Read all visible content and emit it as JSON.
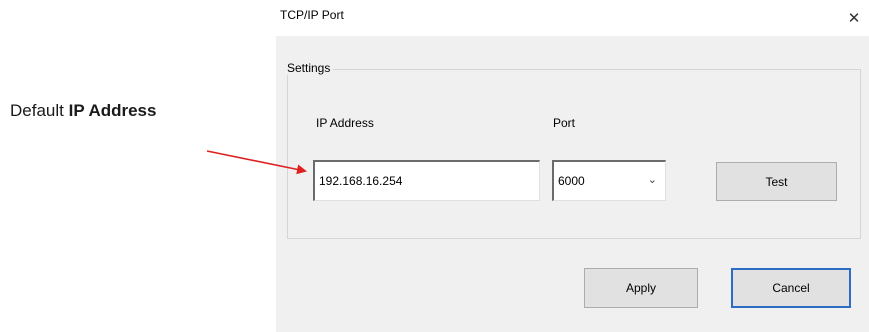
{
  "annotation": {
    "prefix": "Default ",
    "bold": "IP Address"
  },
  "dialog": {
    "title": "TCP/IP Port",
    "close_glyph": "✕",
    "group_label": "Settings",
    "ip_label": "IP Address",
    "ip_value": "192.168.16.254",
    "port_label": "Port",
    "port_value": "6000",
    "port_chevron": "⌄",
    "test_label": "Test",
    "apply_label": "Apply",
    "cancel_label": "Cancel"
  },
  "colors": {
    "arrow": "#e02020",
    "focus_border": "#2b6cc4"
  }
}
